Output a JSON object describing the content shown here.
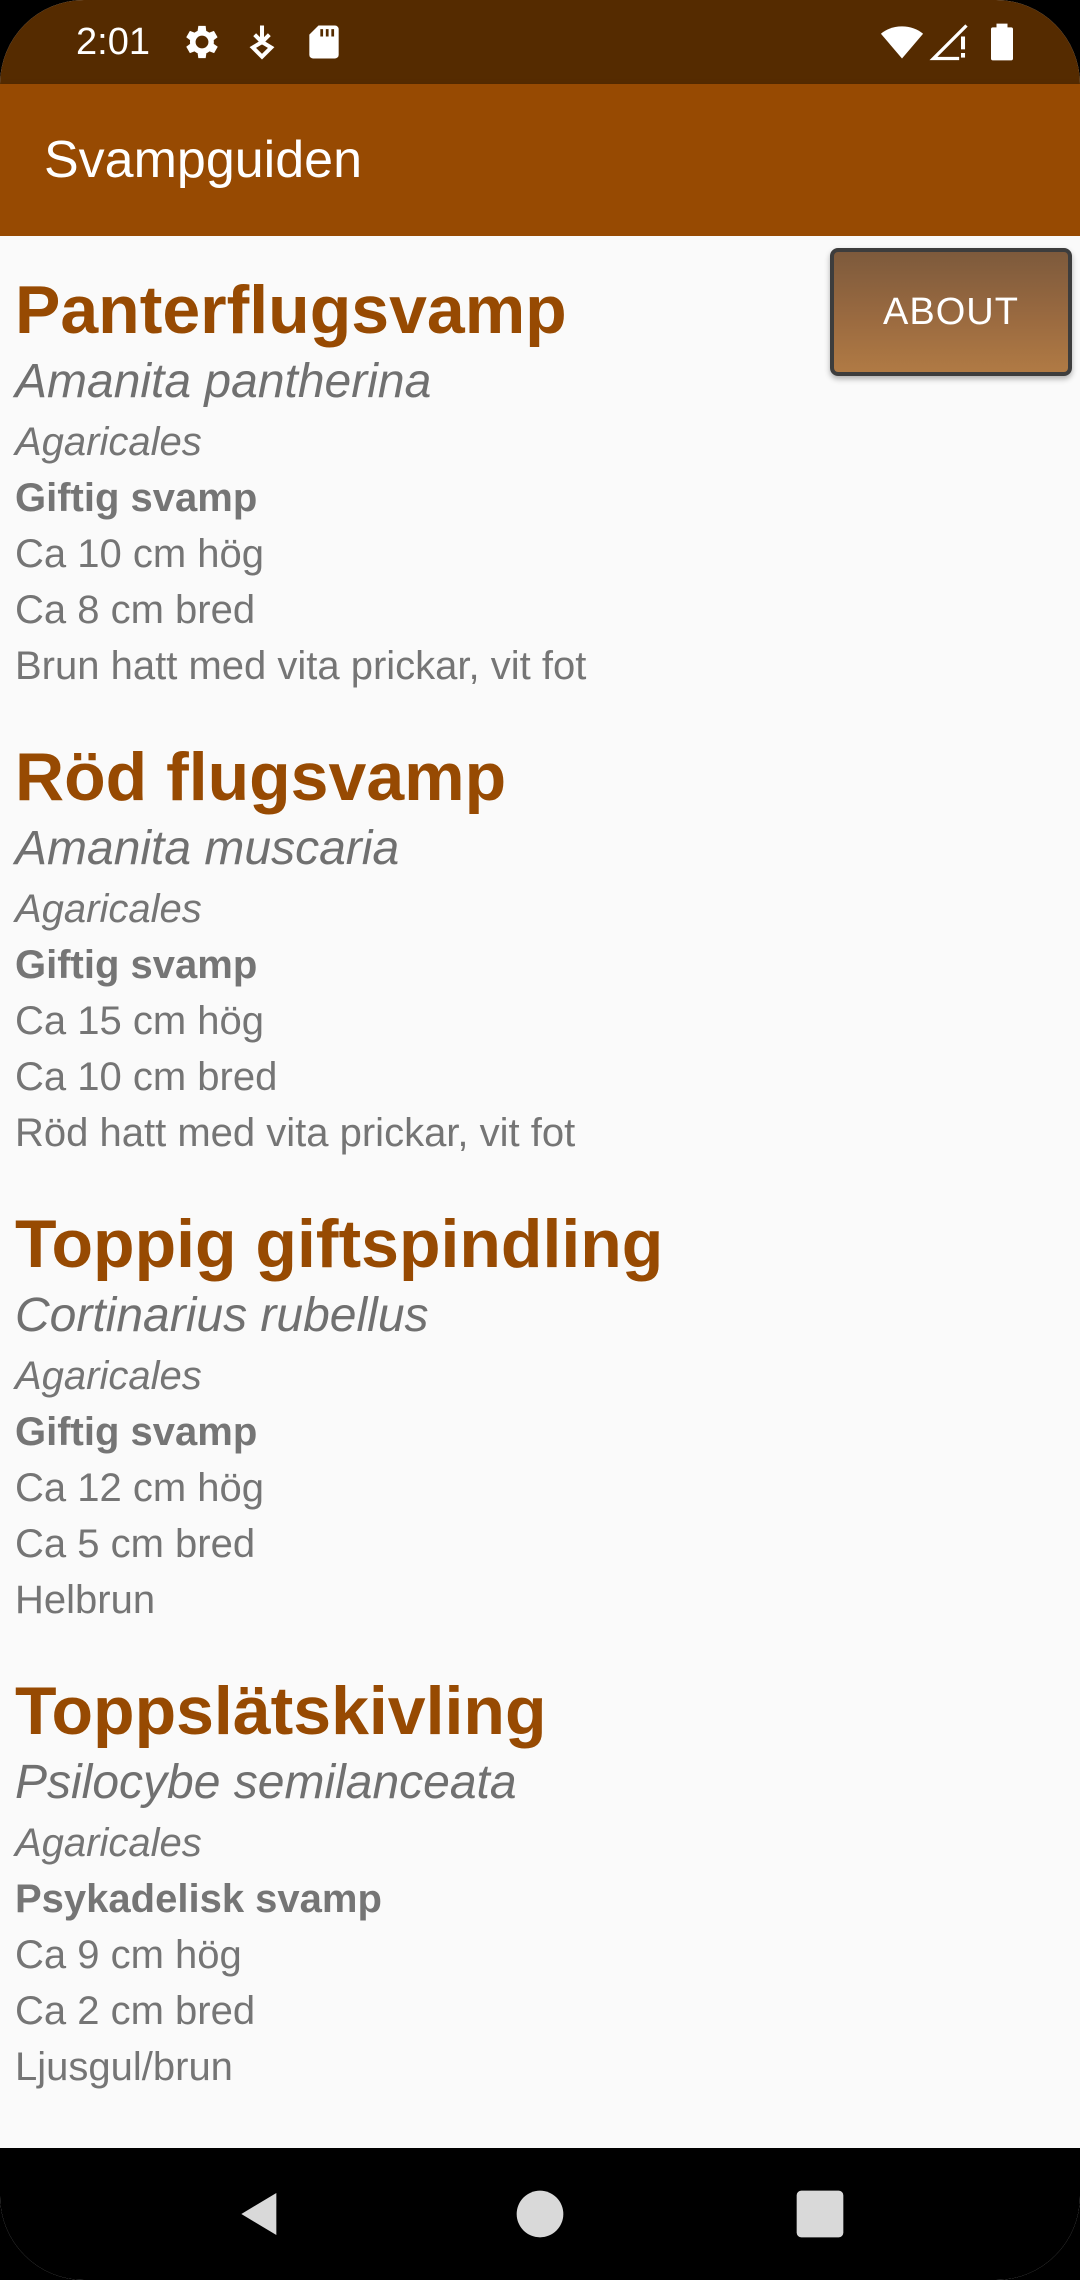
{
  "status_bar": {
    "time": "2:01",
    "icons_left": [
      "gear-icon",
      "download-icon",
      "sd-card-icon"
    ],
    "icons_right": [
      "wifi-icon",
      "signal-icon",
      "battery-icon"
    ]
  },
  "app_bar": {
    "title": "Svampguiden"
  },
  "about_button": {
    "label": "ABOUT"
  },
  "mushrooms": [
    {
      "name": "Panterflugsvamp",
      "latin": "Amanita pantherina",
      "order": "Agaricales",
      "type": "Giftig svamp",
      "height": "Ca 10 cm hög",
      "width": "Ca 8 cm bred",
      "description": "Brun hatt med vita prickar, vit fot"
    },
    {
      "name": "Röd flugsvamp",
      "latin": "Amanita muscaria",
      "order": "Agaricales",
      "type": "Giftig svamp",
      "height": "Ca 15 cm hög",
      "width": "Ca 10 cm bred",
      "description": "Röd hatt med vita prickar, vit fot"
    },
    {
      "name": "Toppig giftspindling",
      "latin": "Cortinarius rubellus",
      "order": "Agaricales",
      "type": "Giftig svamp",
      "height": "Ca 12 cm hög",
      "width": "Ca 5 cm bred",
      "description": "Helbrun"
    },
    {
      "name": "Toppslätskivling",
      "latin": "Psilocybe semilanceata",
      "order": "Agaricales",
      "type": "Psykadelisk svamp",
      "height": "Ca 9 cm hög",
      "width": "Ca 2 cm bred",
      "description": "Ljusgul/brun"
    }
  ],
  "nav_bar": {
    "buttons": [
      "back-icon",
      "home-icon",
      "recents-icon"
    ]
  },
  "colors": {
    "status_bar": "#552b00",
    "app_bar": "#974a02",
    "title_text": "#974a02",
    "body_text": "#757575"
  }
}
